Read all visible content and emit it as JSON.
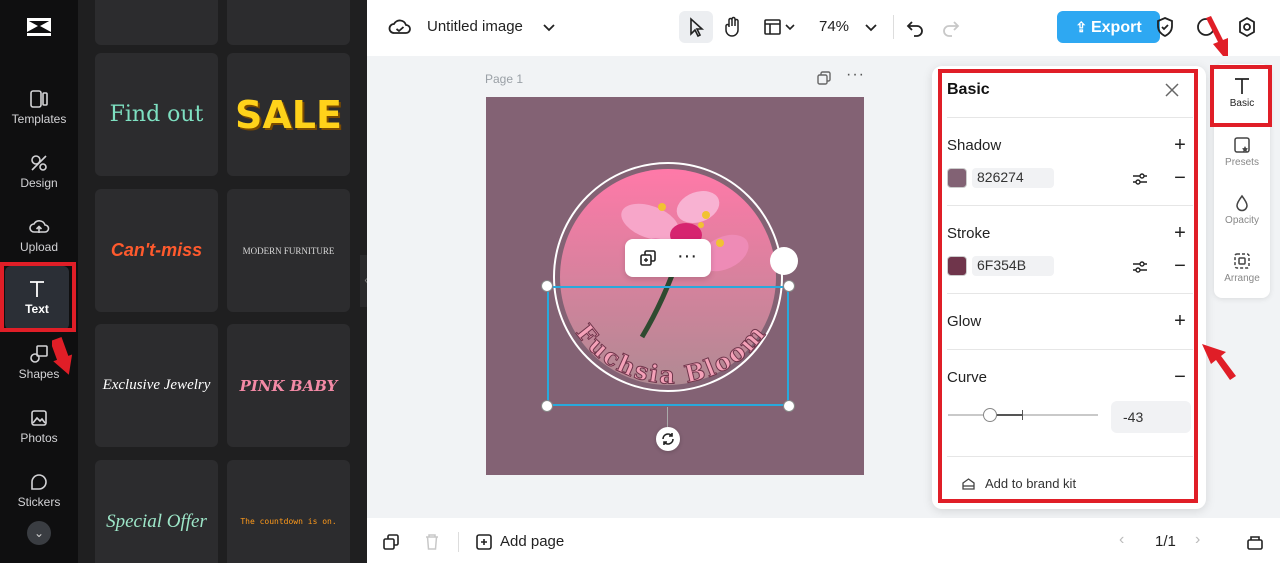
{
  "rail": {
    "items": [
      {
        "label": "Templates"
      },
      {
        "label": "Design"
      },
      {
        "label": "Upload"
      },
      {
        "label": "Text"
      },
      {
        "label": "Shapes"
      },
      {
        "label": "Photos"
      },
      {
        "label": "Stickers"
      }
    ]
  },
  "panel": {
    "tiles": [
      {
        "label": "Find out",
        "color": "#7ee0c1"
      },
      {
        "label": "SALE",
        "color": "#ffd21a"
      },
      {
        "label": "Can't-miss",
        "color": "#ff5a2d"
      },
      {
        "label": "MODERN FURNITURE",
        "color": "#d9d9d9"
      },
      {
        "label": "Exclusive Jewelry",
        "color": "#ffffff"
      },
      {
        "label": "PINK BABY",
        "color": "#f48aa6"
      },
      {
        "label": "Special Offer",
        "color": "#9de6c8"
      },
      {
        "label": "The countdown is on.",
        "color": "#ff9a1a"
      }
    ]
  },
  "topbar": {
    "doc_title": "Untitled image",
    "zoom": "74%",
    "export_label": "Export"
  },
  "canvas": {
    "page_label": "Page 1",
    "design_text": "Fuchsia Bloom"
  },
  "basic_panel": {
    "title": "Basic",
    "shadow_label": "Shadow",
    "shadow_hex": "826274",
    "shadow_color": "#826274",
    "stroke_label": "Stroke",
    "stroke_hex": "6F354B",
    "stroke_color": "#6f354b",
    "glow_label": "Glow",
    "curve_label": "Curve",
    "curve_value": "-43",
    "brand_kit_label": "Add to brand kit"
  },
  "right_rail": {
    "items": [
      {
        "label": "Basic"
      },
      {
        "label": "Presets"
      },
      {
        "label": "Opacity"
      },
      {
        "label": "Arrange"
      }
    ]
  },
  "bottombar": {
    "add_page_label": "Add page",
    "page_counter": "1/1"
  },
  "colors": {
    "accent": "#2ea8f2",
    "annotation_red": "#e01e27",
    "artboard_bg": "#836274",
    "selection": "#29a9dc"
  }
}
